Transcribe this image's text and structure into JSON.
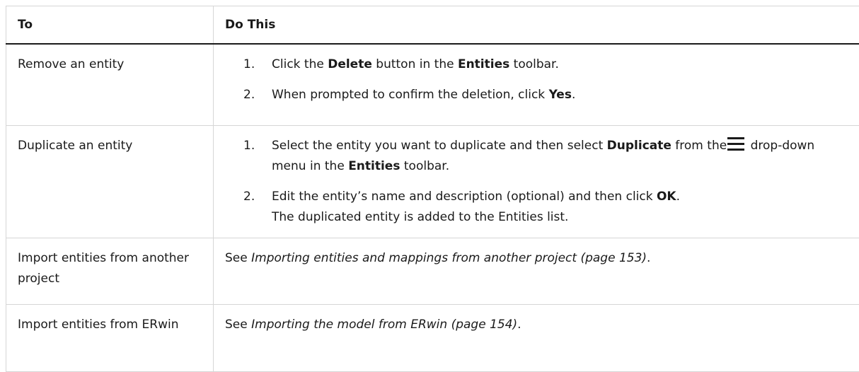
{
  "header": {
    "col1": "To",
    "col2": "Do This"
  },
  "rows": [
    {
      "to": "Remove an entity",
      "steps": [
        {
          "num": "1.",
          "parts": [
            "Click the ",
            "Delete",
            " button in the ",
            "Entities",
            " toolbar."
          ]
        },
        {
          "num": "2.",
          "parts": [
            "When prompted to confirm the deletion, click ",
            "Yes",
            "."
          ]
        }
      ]
    },
    {
      "to": "Duplicate an entity",
      "steps": [
        {
          "num": "1.",
          "parts": [
            "Select the entity you want to duplicate and then select ",
            "Duplicate",
            " from the",
            " drop-down menu in the ",
            "Entities",
            " toolbar."
          ]
        },
        {
          "num": "2.",
          "parts": [
            "Edit the entity’s name and description (optional) and then click ",
            "OK",
            ".",
            "The duplicated entity is added to the Entities list."
          ]
        }
      ]
    },
    {
      "to": "Import entities from another project",
      "see_prefix": "See ",
      "see_link": "Importing entities and mappings from another project (page 153)",
      "see_suffix": "."
    },
    {
      "to": "Import entities from ERwin",
      "see_prefix": "See ",
      "see_link": "Importing the model from ERwin (page 154)",
      "see_suffix": "."
    }
  ],
  "icons": {
    "menu": "hamburger-menu-icon"
  }
}
